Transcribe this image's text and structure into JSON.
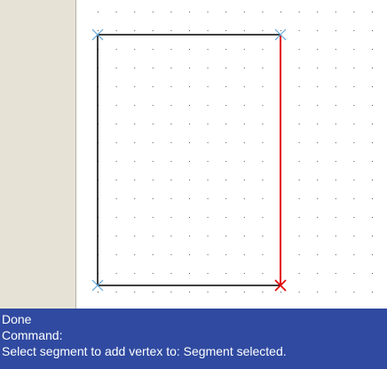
{
  "colors": {
    "panel_background": "#e6e2d6",
    "canvas_background": "#ffffff",
    "grid_dot": "#555555",
    "segment_normal": "#000000",
    "segment_selected": "#e00000",
    "vertex_marker": "#62a8d8",
    "vertex_selected_marker": "#e00000",
    "command_background": "#2f4aa0",
    "command_text": "#ffffff"
  },
  "drawing": {
    "shape": "rectangle",
    "selected_segment": "right-edge",
    "vertex_markers": [
      "top-left",
      "top-right",
      "bottom-left",
      "bottom-right"
    ],
    "selected_vertex": "bottom-right",
    "marker_icon": "x-cross-icon"
  },
  "command_history": [
    {
      "text": "Done"
    },
    {
      "text": "Command:"
    },
    {
      "text": "Select segment to add vertex to: Segment selected."
    }
  ]
}
